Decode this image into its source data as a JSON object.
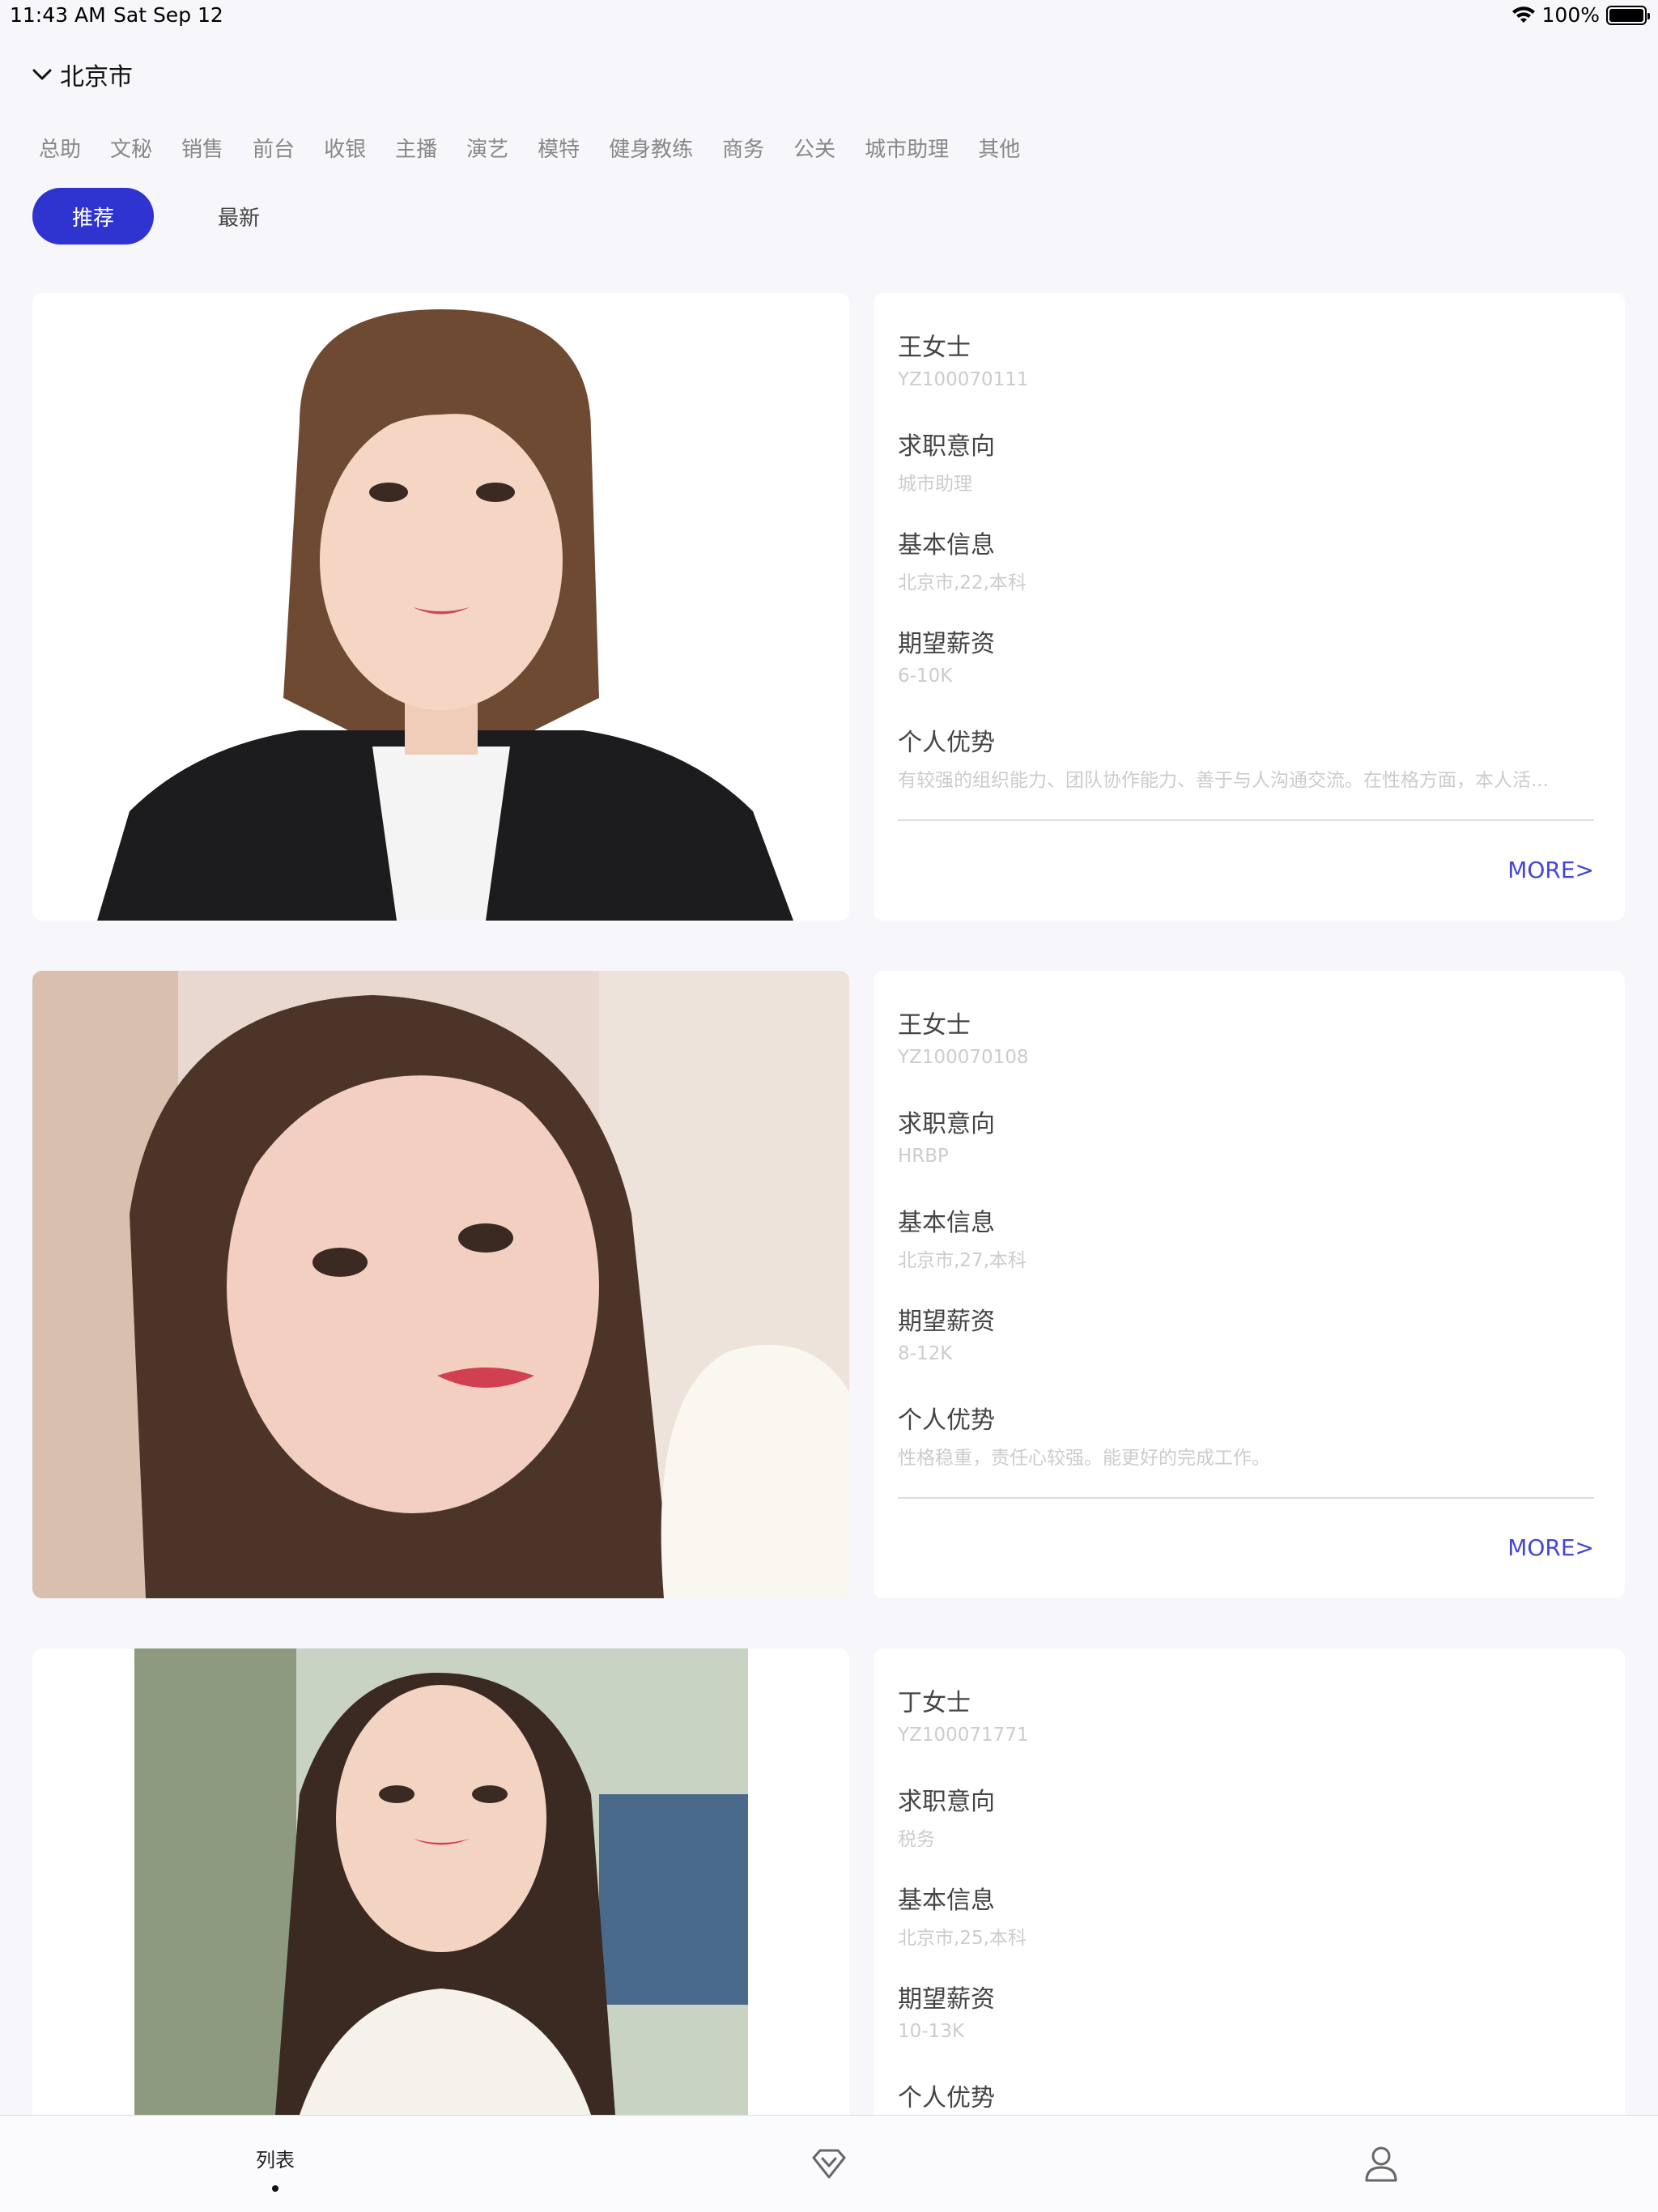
{
  "status": {
    "time": "11:43 AM",
    "date": "Sat Sep 12",
    "battery": "100%"
  },
  "city": {
    "label": "北京市"
  },
  "categories": [
    "总助",
    "文秘",
    "销售",
    "前台",
    "收银",
    "主播",
    "演艺",
    "模特",
    "健身教练",
    "商务",
    "公关",
    "城市助理",
    "其他"
  ],
  "sort": {
    "recommended": "推荐",
    "latest": "最新"
  },
  "cards": [
    {
      "name": "王女士",
      "id": "YZ100070111",
      "intent_label": "求职意向",
      "intent": "城市助理",
      "info_label": "基本信息",
      "info": "北京市,22,本科",
      "salary_label": "期望薪资",
      "salary": "6-10K",
      "advantage_label": "个人优势",
      "advantage": "有较强的组织能力、团队协作能力、善于与人沟通交流。在性格方面，本人活...",
      "more": "MORE>"
    },
    {
      "name": "王女士",
      "id": "YZ100070108",
      "intent_label": "求职意向",
      "intent": "HRBP",
      "info_label": "基本信息",
      "info": "北京市,27,本科",
      "salary_label": "期望薪资",
      "salary": "8-12K",
      "advantage_label": "个人优势",
      "advantage": "性格稳重，责任心较强。能更好的完成工作。",
      "more": "MORE>"
    },
    {
      "name": "丁女士",
      "id": "YZ100071771",
      "intent_label": "求职意向",
      "intent": "税务",
      "info_label": "基本信息",
      "info": "北京市,25,本科",
      "salary_label": "期望薪资",
      "salary": "10-13K",
      "advantage_label": "个人优势"
    }
  ],
  "tabbar": {
    "list_label": "列表"
  },
  "colors": {
    "accent": "#2f33d0",
    "more": "#4446d6",
    "background": "#f6f6fb"
  }
}
